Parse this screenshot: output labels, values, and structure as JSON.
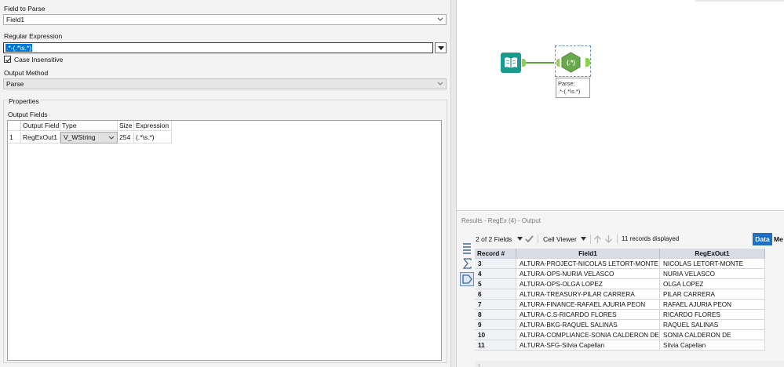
{
  "config": {
    "field_to_parse_label": "Field to Parse",
    "field_to_parse_value": "Field1",
    "regex_label": "Regular Expression",
    "regex_value": ".*-(.*\\s.*)",
    "case_insensitive_label": "Case Insensitive",
    "case_insensitive_checked": true,
    "output_method_label": "Output Method",
    "output_method_value": "Parse",
    "properties_label": "Properties",
    "output_fields_label": "Output Fields",
    "grid": {
      "headers": [
        "",
        "Output Field",
        "Type",
        "Size",
        "Expression"
      ],
      "rows": [
        {
          "index": "1",
          "output_field": "RegExOut1",
          "type": "V_WString",
          "size": "254",
          "expression": "(.*\\s.*)"
        }
      ]
    }
  },
  "canvas": {
    "input_tool_icon": "book-icon",
    "regex_tool_icon": "regex-hex-icon",
    "regex_tool_symbol": "(.*)",
    "annotation_line1": "Parse:",
    "annotation_line2": ".*-(.*\\s.*)"
  },
  "results": {
    "title": "Results - RegEx (4) - Output",
    "fields_selector": "2 of 2 Fields",
    "cell_viewer": "Cell Viewer",
    "records_displayed": "11 records displayed",
    "data_tab": "Data",
    "metadata_tab": "Me",
    "columns": [
      "Record #",
      "Field1",
      "RegExOut1"
    ],
    "rows": [
      [
        "3",
        "ALTURA-PROJECT-NICOLAS LETORT-MONTE",
        "NICOLAS LETORT-MONTE"
      ],
      [
        "4",
        "ALTURA-OPS-NURIA VELASCO",
        "NURIA VELASCO"
      ],
      [
        "5",
        "ALTURA-OPS-OLGA LOPEZ",
        "OLGA LOPEZ"
      ],
      [
        "6",
        "ALTURA-TREASURY-PILAR CARRERA",
        "PILAR CARRERA"
      ],
      [
        "7",
        "ALTURA-FINANCE-RAFAEL AJURIA PEON",
        "RAFAEL AJURIA PEON"
      ],
      [
        "8",
        "ALTURA-C.S-RICARDO FLORES",
        "RICARDO FLORES"
      ],
      [
        "9",
        "ALTURA-BKG-RAQUEL SALINAS",
        "RAQUEL SALINAS"
      ],
      [
        "10",
        "ALTURA-COMPLIANCE-SONIA CALDERON DE",
        "SONIA CALDERON DE"
      ],
      [
        "11",
        "ALTURA-SFG-Silvia Capellan",
        "Silvia Capellan"
      ]
    ]
  },
  "colors": {
    "accent": "#1f6fc2",
    "input_tool": "#1a9a8c",
    "regex_tool": "#6aa84f",
    "anchor": "#8bd44a"
  }
}
